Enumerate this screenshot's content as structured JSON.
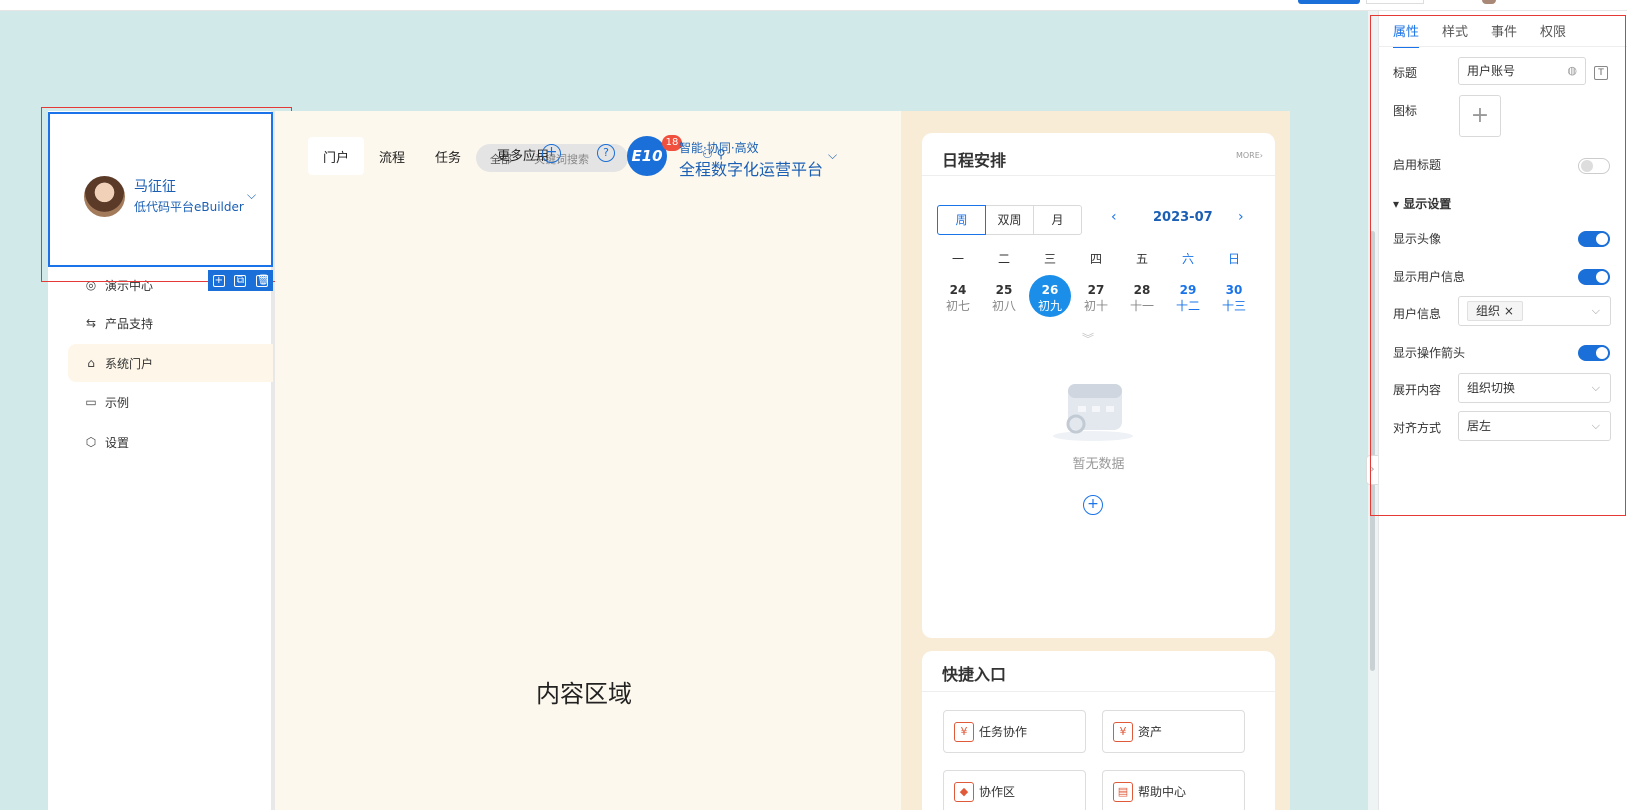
{
  "sidebar": {
    "user": {
      "name": "马征征",
      "org": "低代码平台eBuilder"
    },
    "items": [
      {
        "label": "演示中心",
        "icon": "target-icon"
      },
      {
        "label": "产品支持",
        "icon": "swap-icon"
      },
      {
        "label": "系统门户",
        "icon": "home-icon"
      },
      {
        "label": "示例",
        "icon": "monitor-icon"
      },
      {
        "label": "设置",
        "icon": "settings-icon"
      }
    ]
  },
  "header": {
    "tabs": [
      "门户",
      "流程",
      "任务",
      "更多应用"
    ],
    "search_scope": "全部",
    "search_placeholder": "关键词搜索",
    "logo_text": "E10",
    "badge_count": "18",
    "slogan": "智能·协同·高效",
    "platform_name": "全程数字化运营平台"
  },
  "main": {
    "content_label": "内容区域"
  },
  "schedule": {
    "title": "日程安排",
    "more": "MORE›",
    "views": [
      "周",
      "双周",
      "月"
    ],
    "month": "2023-07",
    "weekdays": [
      "一",
      "二",
      "三",
      "四",
      "五",
      "六",
      "日"
    ],
    "days": [
      {
        "n": "24",
        "l": "初七"
      },
      {
        "n": "25",
        "l": "初八"
      },
      {
        "n": "26",
        "l": "初九"
      },
      {
        "n": "27",
        "l": "初十"
      },
      {
        "n": "28",
        "l": "十一"
      },
      {
        "n": "29",
        "l": "十二"
      },
      {
        "n": "30",
        "l": "十三"
      }
    ],
    "empty_text": "暂无数据"
  },
  "quick": {
    "title": "快捷入口",
    "items": [
      "任务协作",
      "资产",
      "协作区",
      "帮助中心"
    ]
  },
  "panel": {
    "tabs": [
      "属性",
      "样式",
      "事件",
      "权限"
    ],
    "title_label": "标题",
    "title_value": "用户账号",
    "icon_label": "图标",
    "enable_title_label": "启用标题",
    "section_label": "显示设置",
    "show_avatar_label": "显示头像",
    "show_userinfo_label": "显示用户信息",
    "userinfo_label": "用户信息",
    "userinfo_tag": "组织",
    "show_arrow_label": "显示操作箭头",
    "expand_label": "展开内容",
    "expand_value": "组织切换",
    "align_label": "对齐方式",
    "align_value": "居左"
  },
  "colors": {
    "accent": "#1a6fd8",
    "selection": "#e53935",
    "canvas": "#d2e9ea"
  }
}
